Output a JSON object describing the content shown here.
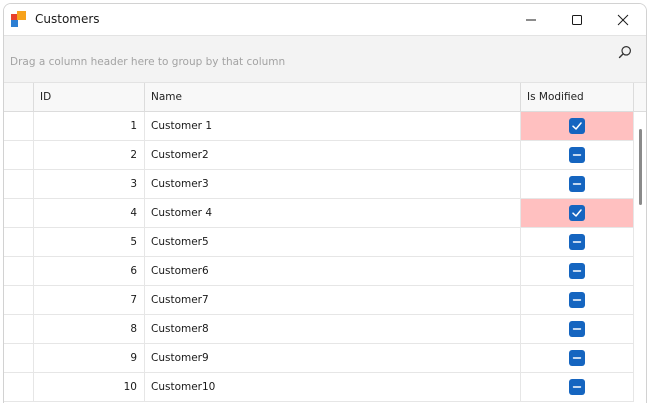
{
  "window": {
    "title": "Customers",
    "icon": "app-logo-icon"
  },
  "group_panel": {
    "hint": "Drag a column header here to group by that column",
    "search_icon": "search-icon"
  },
  "columns": {
    "id": "ID",
    "name": "Name",
    "is_modified": "Is Modified"
  },
  "rows": [
    {
      "id": "1",
      "name": "Customer 1",
      "is_modified": true
    },
    {
      "id": "2",
      "name": "Customer2",
      "is_modified": null
    },
    {
      "id": "3",
      "name": "Customer3",
      "is_modified": null
    },
    {
      "id": "4",
      "name": "Customer 4",
      "is_modified": true
    },
    {
      "id": "5",
      "name": "Customer5",
      "is_modified": null
    },
    {
      "id": "6",
      "name": "Customer6",
      "is_modified": null
    },
    {
      "id": "7",
      "name": "Customer7",
      "is_modified": null
    },
    {
      "id": "8",
      "name": "Customer8",
      "is_modified": null
    },
    {
      "id": "9",
      "name": "Customer9",
      "is_modified": null
    },
    {
      "id": "10",
      "name": "Customer10",
      "is_modified": null
    }
  ],
  "colors": {
    "checkbox": "#1565c0",
    "modified_highlight": "#ffc0c0",
    "logo_red": "#e8412c",
    "logo_orange": "#f7a21b",
    "logo_blue": "#2d7fd3"
  }
}
